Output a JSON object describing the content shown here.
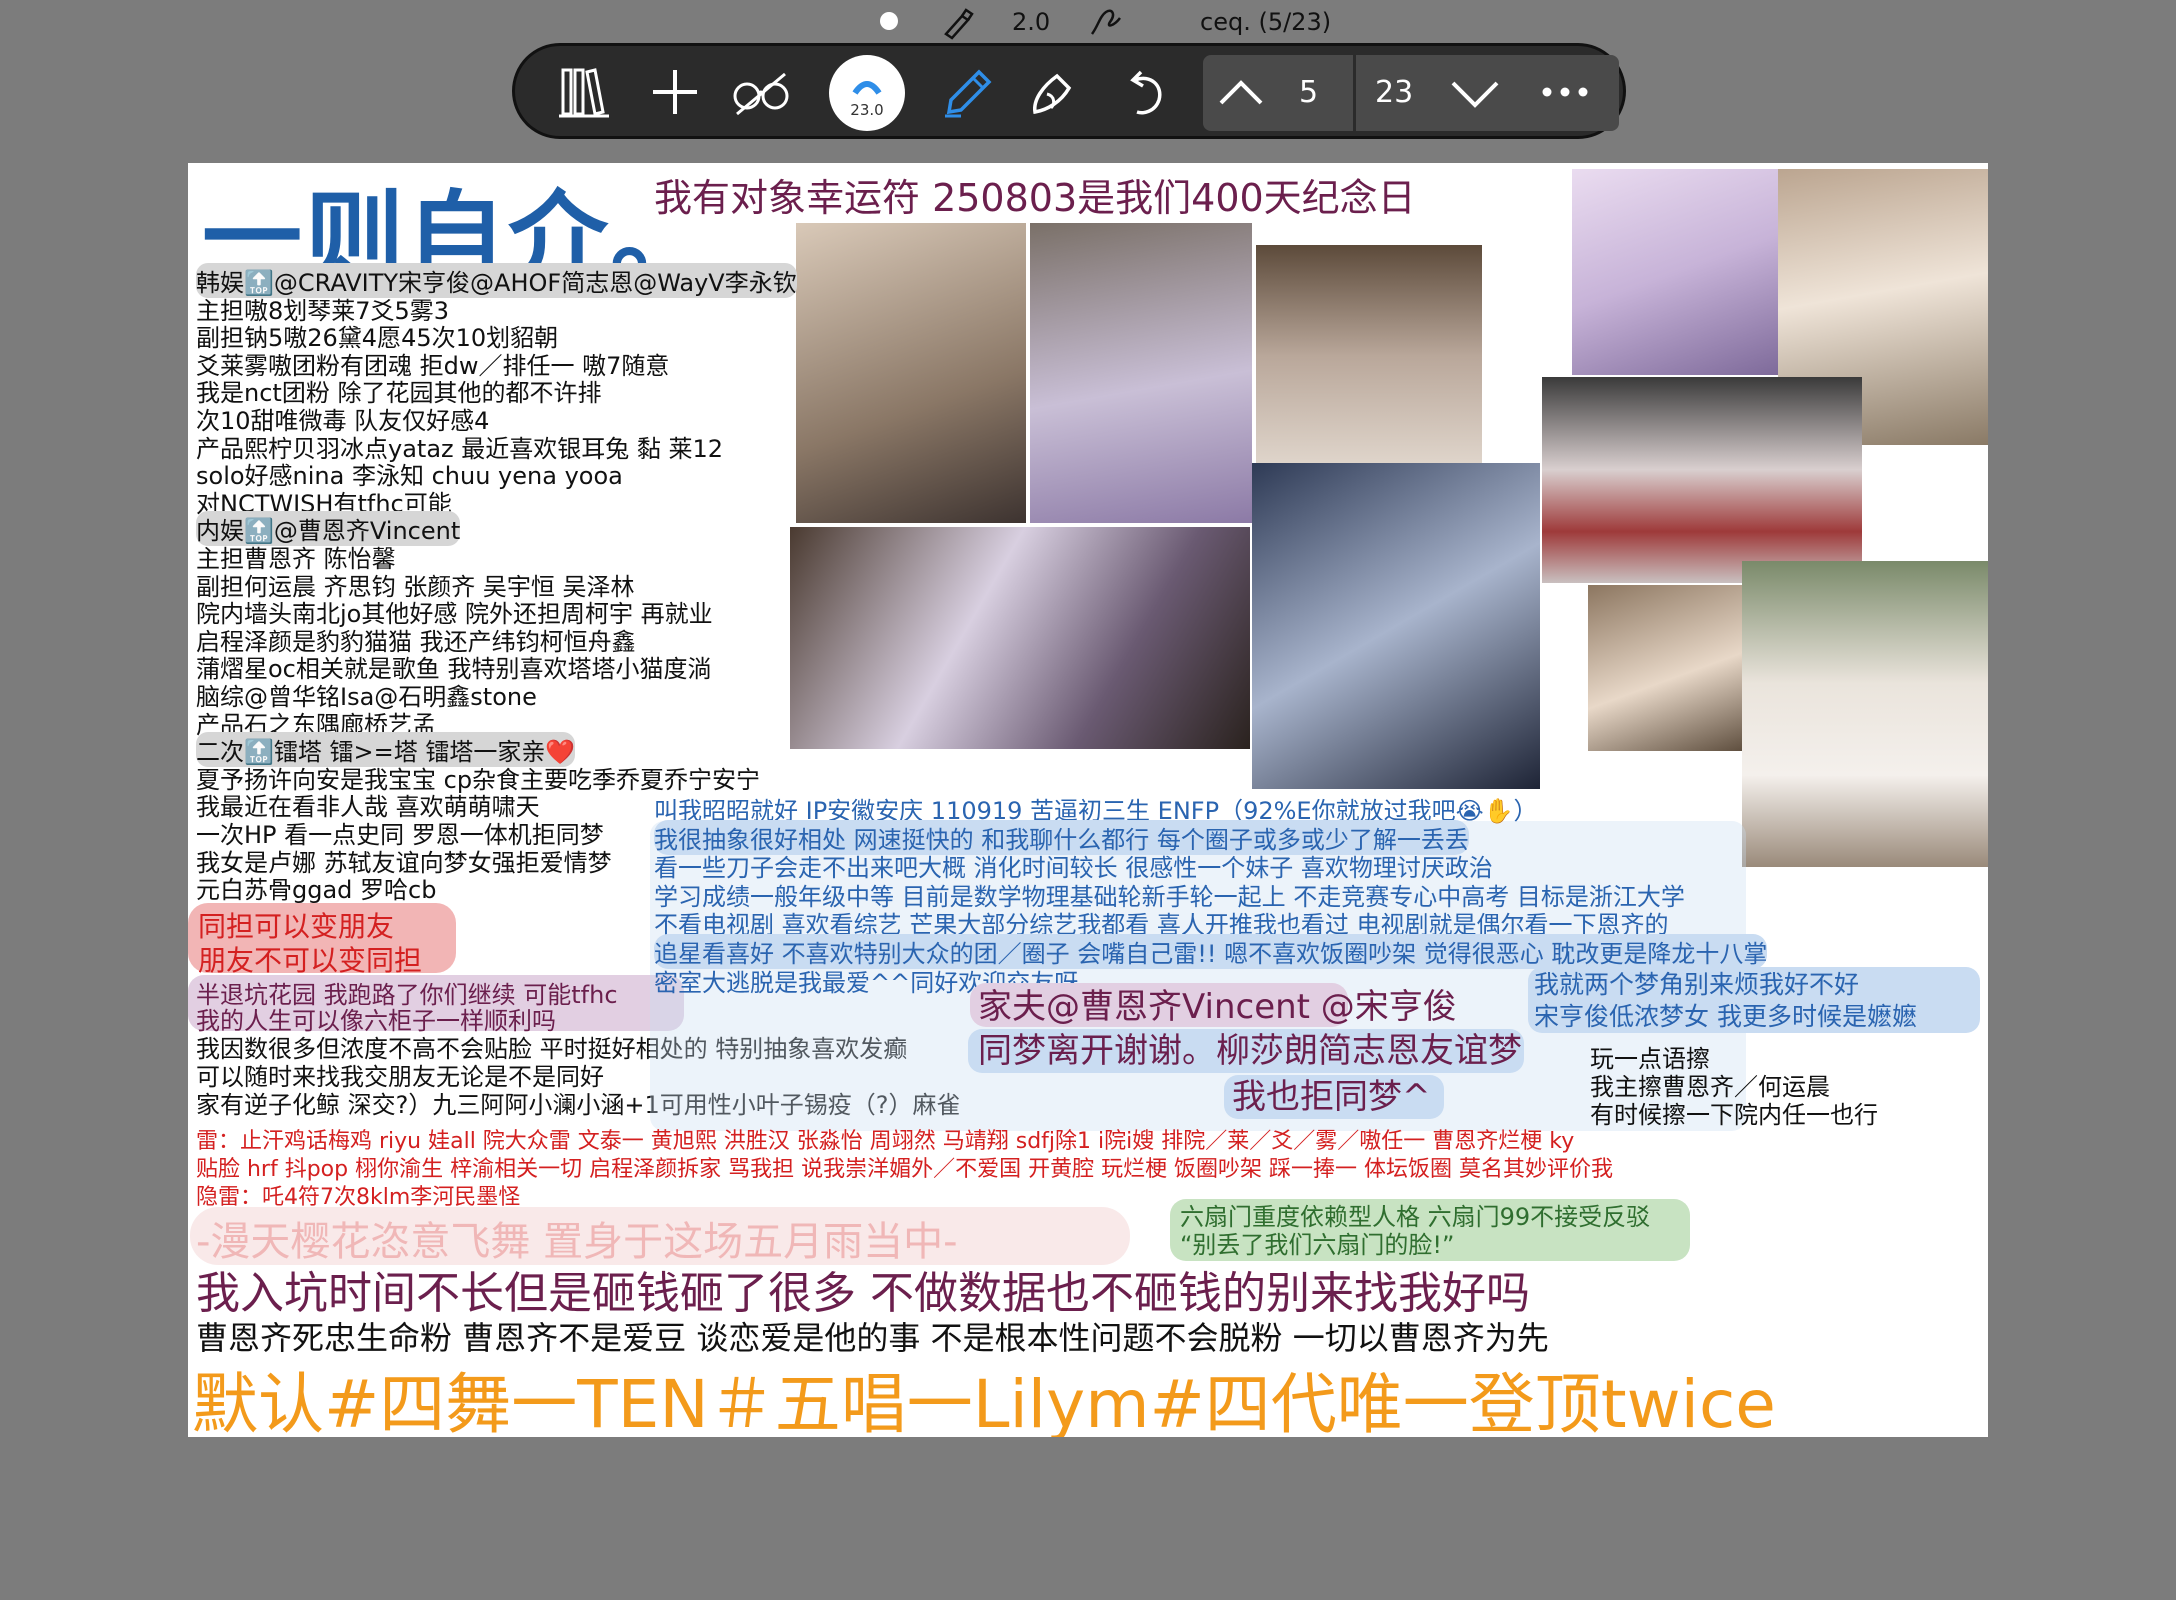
{
  "status": {
    "pen_size": "2.0",
    "doc_title": "ceq. (5/23)"
  },
  "toolbar": {
    "zoom_label": "23.0",
    "current_page": "5",
    "total_pages": "23"
  },
  "page": {
    "title": "一则自介。",
    "top_line": "我有对象幸运符 250803是我们400天纪念日",
    "left_lines": [
      "韩娱🔝@CRAVITY宋亨俊@AHOF简志恩@WayV李永钦",
      "主担嗷8划琴莱7爻5雾3",
      "副担钠5嗷26黛4愿45次10划貂朝",
      "爻莱雾嗷团粉有团魂 拒dw／排任一 嗷7随意",
      "我是nct团粉 除了花园其他的都不许排",
      "次10甜唯微毒 队友仅好感4",
      "产品熙柠贝羽冰点yataz 最近喜欢银耳兔 黏 莱12",
      "solo好感nina 李泳知 chuu yena yooa",
      "对NCTWISH有tfhc可能",
      "内娱🔝@曹恩齐Vincent",
      "主担曹恩齐 陈怡馨",
      "副担何运晨 齐思钧 张颜齐 吴宇恒 吴泽林",
      "院内墙头南北jo其他好感   院外还担周柯宇 再就业",
      "启程泽颜是豹豹猫猫 我还产纬钧柯恒舟鑫",
      "蒲熠星oc相关就是歌鱼 我特别喜欢塔塔小猫度淌",
      "脑综@曾华铭Isa@石明鑫stone",
      "产品石之东隅廊桥艺孟",
      "二次🔝镭塔 镭>=塔 镭塔一家亲❤️",
      "夏予扬许向安是我宝宝 cp杂食主要吃季乔夏乔宁安宁",
      "我最近在看非人哉 喜欢萌萌啸天",
      "一次HP 看一点史同 罗恩一体机拒同梦",
      "我女是卢娜 苏轼友谊向梦女强拒爱情梦",
      "元白苏骨ggad 罗哈cb"
    ],
    "red_box": [
      "同担可以变朋友",
      "朋友不可以变同担"
    ],
    "purple_box": [
      "半退坑花园 我跑路了你们继续 可能tfhc",
      "我的人生可以像六柜子一样顺利吗"
    ],
    "plain_lines": [
      "我因数很多但浓度不高不会贴脸 平时挺好相处的 特别抽象喜欢发癫",
      "可以随时来找我交朋友无论是不是同好",
      "家有逆子化鲸 深交?）九三阿阿小澜小涵+1可用性小叶子锡疫（?）麻雀"
    ],
    "blue_lines": [
      "叫我昭昭就好 IP安徽安庆 110919 苦逼初三生 ENFP（92%E你就放过我吧😭✋）",
      "我很抽象很好相处 网速挺快的 和我聊什么都行 每个圈子或多或少了解一丢丢",
      "看一些刀子会走不出来吧大概 消化时间较长 很感性一个妹子 喜欢物理讨厌政治",
      "学习成绩一般年级中等 目前是数学物理基础轮新手轮一起上 不走竞赛专心中高考 目标是浙江大学",
      "不看电视剧 喜欢看综艺 芒果大部分综艺我都看 喜人开推我也看过 电视剧就是偶尔看一下恩齐的",
      "追星看喜好 不喜欢特别大众的团／圈子 会嘴自己雷!! 嗯不喜欢饭圈吵架 觉得很恶心 耽改更是降龙十八掌",
      "密室大逃脱是我最爱^^同好欢迎交友呀"
    ],
    "husband_lines": [
      "家夫@曹恩齐Vincent @宋亨俊",
      "同梦离开谢谢。柳莎朗简志恩友谊梦",
      "我也拒同梦^"
    ],
    "dream_lines": [
      "我就两个梦角别来烦我好不好",
      "宋亨俊低浓梦女 我更多时候是嬷嬷"
    ],
    "rub_lines": [
      "玩一点语擦",
      "我主擦曹恩齐／何运晨",
      "有时候擦一下院内任一也行"
    ],
    "thunder_lines": [
      "雷：止汗鸡话梅鸡 riyu 娃all 院大众雷 文泰一 黄旭熙 洪胜汉 张淼怡 周翊然 马靖翔 sdfj除1 i院i嫂 排院／莱／爻／雾／嗷任一 曹恩齐烂梗 ky",
      "贴脸 hrf 抖pop 栩你渝生 梓渝相关一切 启程泽颜拆家 骂我担 说我崇洋媚外／不爱国 开黄腔 玩烂梗 饭圈吵架 踩一捧一 体坛饭圈 莫名其妙评价我",
      "隐雷：吒4符7次8klm李河民墨怪"
    ],
    "sakura_line": "-漫天樱花恣意飞舞 置身于这场五月雨当中-",
    "green_lines": [
      "六扇门重度依赖型人格 六扇门99不接受反驳",
      "“别丢了我们六扇门的脸!”"
    ],
    "big_line": "我入坑时间不长但是砸钱砸了很多 不做数据也不砸钱的别来找我好吗",
    "fan_line": "曹恩齐死忠生命粉 曹恩齐不是爱豆 谈恋爱是他的事 不是根本性问题不会脱粉 一切以曹恩齐为先",
    "default_line": "默认#四舞一TEN＃五唱一Lilym#四代唯一登顶twice"
  },
  "colors": {
    "title_blue": "#1f5fa8",
    "maroon": "#6b1f4d",
    "blue_text": "#2a64b0",
    "red_text": "#d42020",
    "orange": "#f39a1b",
    "toolbar_bg": "#2b2b2b",
    "pen_blue": "#2f8ee8"
  },
  "icons": [
    "brush-icon",
    "signature-icon",
    "library-icon",
    "plus-icon",
    "glasses-icon",
    "pen-icon",
    "eraser-icon",
    "undo-icon",
    "chevron-up-icon",
    "chevron-down-icon",
    "more-icon"
  ]
}
